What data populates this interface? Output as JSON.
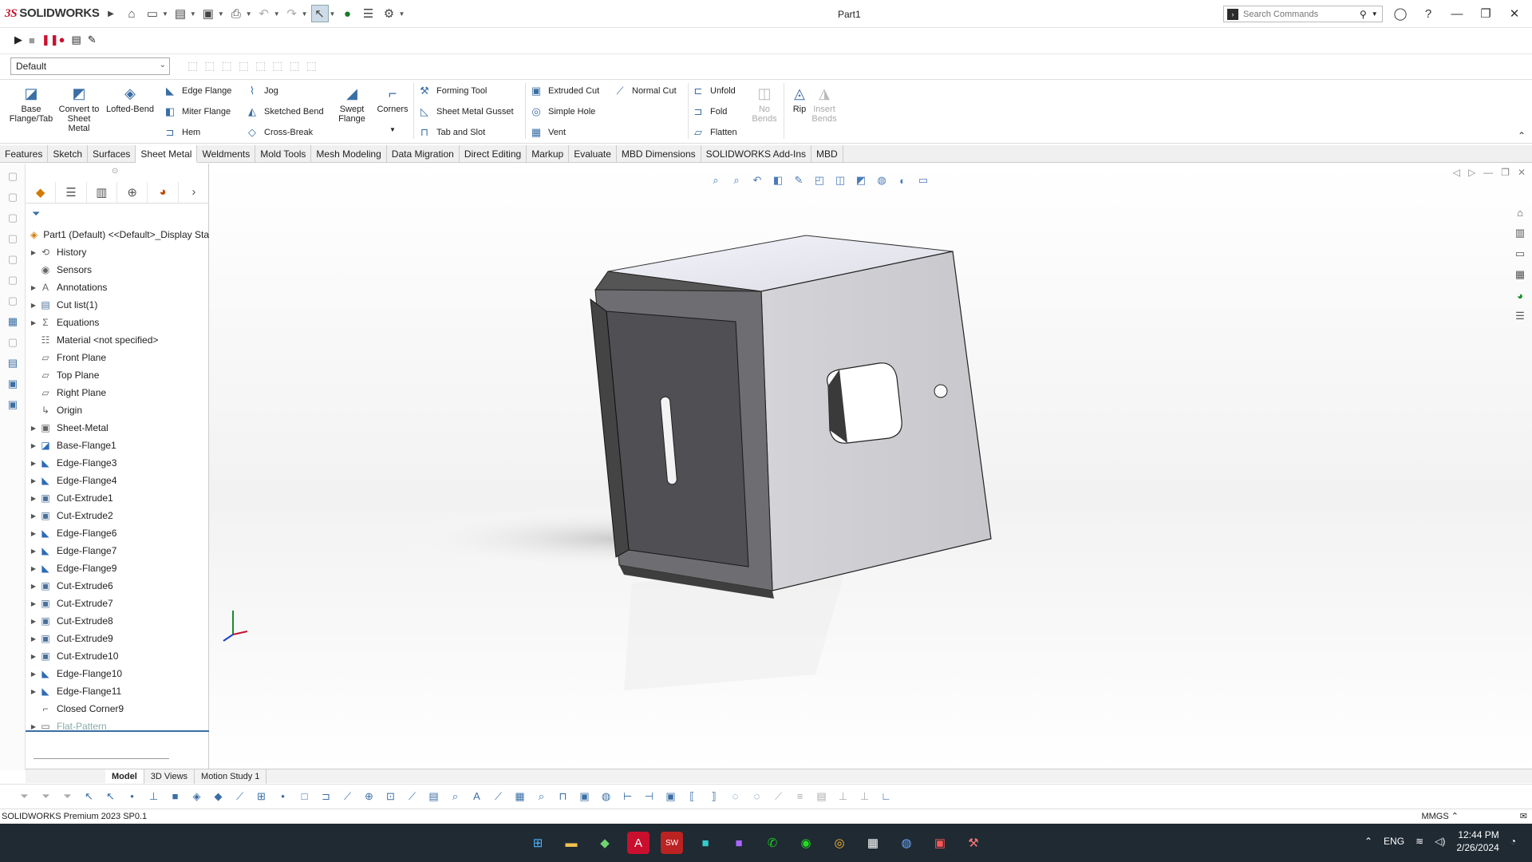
{
  "app": {
    "logo_text": "SOLIDWORKS",
    "document_title": "Part1",
    "search_placeholder": "Search Commands"
  },
  "configuration": {
    "selected": "Default"
  },
  "ribbon": {
    "big_buttons": [
      {
        "label": "Base Flange/Tab",
        "icon": "base-flange-icon"
      },
      {
        "label": "Convert to Sheet Metal",
        "icon": "convert-icon"
      },
      {
        "label": "Lofted-Bend",
        "icon": "lofted-bend-icon"
      },
      {
        "label": "Swept Flange",
        "icon": "swept-flange-icon"
      },
      {
        "label": "Corners",
        "icon": "corners-icon"
      },
      {
        "label": "No Bends",
        "icon": "no-bends-icon"
      },
      {
        "label": "Rip",
        "icon": "rip-icon"
      },
      {
        "label": "Insert Bends",
        "icon": "insert-bends-icon"
      }
    ],
    "col1": [
      "Edge Flange",
      "Miter Flange",
      "Hem"
    ],
    "col2": [
      "Jog",
      "Sketched Bend",
      "Cross-Break"
    ],
    "col3": [
      "Forming Tool",
      "Sheet Metal Gusset",
      "Tab and Slot"
    ],
    "col4": [
      "Extruded Cut",
      "Simple Hole",
      "Vent"
    ],
    "col5": [
      "Normal Cut"
    ],
    "col6": [
      "Unfold",
      "Fold",
      "Flatten"
    ]
  },
  "tabs": [
    "Features",
    "Sketch",
    "Surfaces",
    "Sheet Metal",
    "Weldments",
    "Mold Tools",
    "Mesh Modeling",
    "Data Migration",
    "Direct Editing",
    "Markup",
    "Evaluate",
    "MBD Dimensions",
    "SOLIDWORKS Add-Ins",
    "MBD"
  ],
  "active_tab": "Sheet Metal",
  "feature_tree": {
    "root": "Part1 (Default) <<Default>_Display Sta",
    "items": [
      {
        "label": "History",
        "icon": "history-icon",
        "expandable": true
      },
      {
        "label": "Sensors",
        "icon": "sensors-icon",
        "expandable": false
      },
      {
        "label": "Annotations",
        "icon": "annotations-icon",
        "expandable": true
      },
      {
        "label": "Cut list(1)",
        "icon": "cut-list-icon",
        "expandable": true
      },
      {
        "label": "Equations",
        "icon": "equations-icon",
        "expandable": true
      },
      {
        "label": "Material <not specified>",
        "icon": "material-icon",
        "expandable": false
      },
      {
        "label": "Front Plane",
        "icon": "plane-icon",
        "expandable": false
      },
      {
        "label": "Top Plane",
        "icon": "plane-icon",
        "expandable": false
      },
      {
        "label": "Right Plane",
        "icon": "plane-icon",
        "expandable": false
      },
      {
        "label": "Origin",
        "icon": "origin-icon",
        "expandable": false
      },
      {
        "label": "Sheet-Metal",
        "icon": "sheet-metal-icon",
        "expandable": true
      },
      {
        "label": "Base-Flange1",
        "icon": "base-flange-icon",
        "expandable": true
      },
      {
        "label": "Edge-Flange3",
        "icon": "edge-flange-icon",
        "expandable": true
      },
      {
        "label": "Edge-Flange4",
        "icon": "edge-flange-icon",
        "expandable": true
      },
      {
        "label": "Cut-Extrude1",
        "icon": "cut-extrude-icon",
        "expandable": true
      },
      {
        "label": "Cut-Extrude2",
        "icon": "cut-extrude-icon",
        "expandable": true
      },
      {
        "label": "Edge-Flange6",
        "icon": "edge-flange-icon",
        "expandable": true
      },
      {
        "label": "Edge-Flange7",
        "icon": "edge-flange-icon",
        "expandable": true
      },
      {
        "label": "Edge-Flange9",
        "icon": "edge-flange-icon",
        "expandable": true
      },
      {
        "label": "Cut-Extrude6",
        "icon": "cut-extrude-icon",
        "expandable": true
      },
      {
        "label": "Cut-Extrude7",
        "icon": "cut-extrude-icon",
        "expandable": true
      },
      {
        "label": "Cut-Extrude8",
        "icon": "cut-extrude-icon",
        "expandable": true
      },
      {
        "label": "Cut-Extrude9",
        "icon": "cut-extrude-icon",
        "expandable": true
      },
      {
        "label": "Cut-Extrude10",
        "icon": "cut-extrude-icon",
        "expandable": true
      },
      {
        "label": "Edge-Flange10",
        "icon": "edge-flange-icon",
        "expandable": true
      },
      {
        "label": "Edge-Flange11",
        "icon": "edge-flange-icon",
        "expandable": true
      },
      {
        "label": "Closed Corner9",
        "icon": "closed-corner-icon",
        "expandable": false
      },
      {
        "label": "Flat-Pattern",
        "icon": "flat-pattern-icon",
        "expandable": true,
        "suppressed": true
      }
    ]
  },
  "bottom_tabs": [
    "Model",
    "3D Views",
    "Motion Study 1"
  ],
  "active_bottom_tab": "Model",
  "status": {
    "product": "SOLIDWORKS Premium 2023 SP0.1",
    "units": "MMGS"
  },
  "taskbar": {
    "lang": "ENG",
    "time": "12:44 PM",
    "date": "2/26/2024"
  },
  "colors": {
    "brand_red": "#c8102e",
    "accent_blue": "#3a6ea5",
    "taskbar": "#1f2a33"
  }
}
